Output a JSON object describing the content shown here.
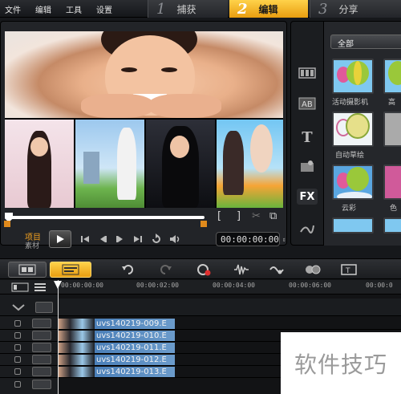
{
  "menu": {
    "file": "文件",
    "edit": "编辑",
    "tools": "工具",
    "settings": "设置"
  },
  "steps": [
    {
      "num": "1",
      "label": "捕获"
    },
    {
      "num": "2",
      "label": "编辑"
    },
    {
      "num": "3",
      "label": "分享"
    }
  ],
  "player": {
    "project_label": "项目",
    "clip_label": "素材",
    "timecode": "00:00:00:00"
  },
  "library": {
    "filter": "全部",
    "items": [
      "活动摄影机",
      "高",
      "自动草绘",
      "",
      "云彩",
      "色"
    ]
  },
  "timeline": {
    "ticks": [
      "00:00:00:00",
      "00:00:02:00",
      "00:00:04:00",
      "00:00:06:00",
      "00:00:0"
    ],
    "clips": [
      "uvs140219-009.E",
      "uvs140219-010.E",
      "uvs140219-011.E",
      "uvs140219-012.E",
      "uvs140219-013.E"
    ]
  },
  "watermark": "软件技巧",
  "colors": {
    "accent": "#f0a020",
    "clip": "#4a7fb8"
  }
}
